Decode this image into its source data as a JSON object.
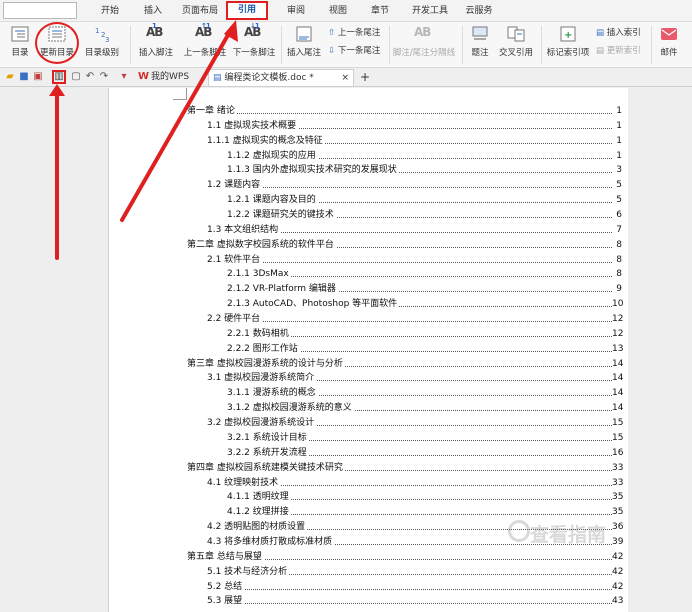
{
  "menubar": {
    "tabs": [
      "开始",
      "插入",
      "页面布局",
      "引用",
      "审阅",
      "视图",
      "章节",
      "开发工具",
      "云服务"
    ],
    "active_tab": "引用"
  },
  "ribbon": {
    "toc": "目录",
    "update_toc": "更新目录",
    "toc_level": "目录级别",
    "insert_footnote": "插入脚注",
    "prev_footnote": "上一条脚注",
    "next_footnote": "下一条脚注",
    "insert_endnote": "插入尾注",
    "prev_endnote": "上一条尾注",
    "next_endnote": "下一条尾注",
    "footnote_separator": "脚注/尾注分隔线",
    "caption": "题注",
    "cross_reference": "交叉引用",
    "mark_index_entry": "标记索引项",
    "insert_index": "插入索引",
    "update_index": "更新索引",
    "mail": "邮件",
    "ab_glyph": "AB",
    "footnote_sup_1": "1",
    "footnote_sup_2": "↓1",
    "footnote_sup_3": "↑1"
  },
  "tabs": {
    "home_tab": "我的WPS",
    "doc_tab": "编程类论文模板.doc *",
    "wps_logo": "W",
    "close": "×",
    "new_tab": "+"
  },
  "toc": [
    {
      "text": "第一章  绪论",
      "page": "1",
      "level": 0
    },
    {
      "text": "1.1  虚拟现实技术概要",
      "page": "1",
      "level": 1
    },
    {
      "text": "1.1.1  虚拟现实的概念及特征",
      "page": "1",
      "level": 1
    },
    {
      "text": "1.1.2  虚拟现实的应用",
      "page": "1",
      "level": 2
    },
    {
      "text": "1.1.3  国内外虚拟现实技术研究的发展现状",
      "page": "3",
      "level": 2
    },
    {
      "text": "1.2  课题内容",
      "page": "5",
      "level": 1
    },
    {
      "text": "1.2.1  课题内容及目的",
      "page": "5",
      "level": 2
    },
    {
      "text": "1.2.2  课题研究关的键技术",
      "page": "6",
      "level": 2
    },
    {
      "text": "1.3  本文组织结构",
      "page": "7",
      "level": 1
    },
    {
      "text": "第二章  虚拟数字校园系统的软件平台",
      "page": "8",
      "level": 0
    },
    {
      "text": "2.1  软件平台",
      "page": "8",
      "level": 1
    },
    {
      "text": "2.1.1  3DsMax",
      "page": "8",
      "level": 2
    },
    {
      "text": "2.1.2  VR-Platform 编辑器",
      "page": "9",
      "level": 2
    },
    {
      "text": "2.1.3  AutoCAD、Photoshop 等平面软件",
      "page": "10",
      "level": 2
    },
    {
      "text": "2.2  硬件平台",
      "page": "12",
      "level": 1
    },
    {
      "text": "2.2.1  数码相机",
      "page": "12",
      "level": 2
    },
    {
      "text": "2.2.2  图形工作站",
      "page": "13",
      "level": 2
    },
    {
      "text": "第三章  虚拟校园漫游系统的设计与分析",
      "page": "14",
      "level": 0
    },
    {
      "text": "3.1  虚拟校园漫游系统简介",
      "page": "14",
      "level": 1
    },
    {
      "text": "3.1.1  漫游系统的概念",
      "page": "14",
      "level": 2
    },
    {
      "text": "3.1.2  虚拟校园漫游系统的意义",
      "page": "14",
      "level": 2
    },
    {
      "text": "3.2  虚拟校园漫游系统设计",
      "page": "15",
      "level": 1
    },
    {
      "text": "3.2.1  系统设计目标",
      "page": "15",
      "level": 2
    },
    {
      "text": "3.2.2 系统开发流程",
      "page": "16",
      "level": 2
    },
    {
      "text": "第四章  虚拟校园系统建模关键技术研究",
      "page": "33",
      "level": 0
    },
    {
      "text": "4.1 纹理映射技术",
      "page": "33",
      "level": 1
    },
    {
      "text": "4.1.1  透明纹理",
      "page": "35",
      "level": 2
    },
    {
      "text": "4.1.2  纹理拼接",
      "page": "35",
      "level": 2
    },
    {
      "text": "4.2  透明贴图的材质设置",
      "page": "36",
      "level": 1
    },
    {
      "text": "4.3  将多维材质打散成标准材质",
      "page": "39",
      "level": 1
    },
    {
      "text": "第五章  总结与展望",
      "page": "42",
      "level": 0
    },
    {
      "text": "5.1  技术与经济分析",
      "page": "42",
      "level": 1
    },
    {
      "text": "5.2  总结",
      "page": "42",
      "level": 1
    },
    {
      "text": "5.3  展望",
      "page": "43",
      "level": 1
    }
  ],
  "watermark": "查看指南",
  "colors": {
    "annotation_red": "#e02020",
    "active_tab_text": "#1e5aa8",
    "wps_red": "#d42b2b"
  }
}
